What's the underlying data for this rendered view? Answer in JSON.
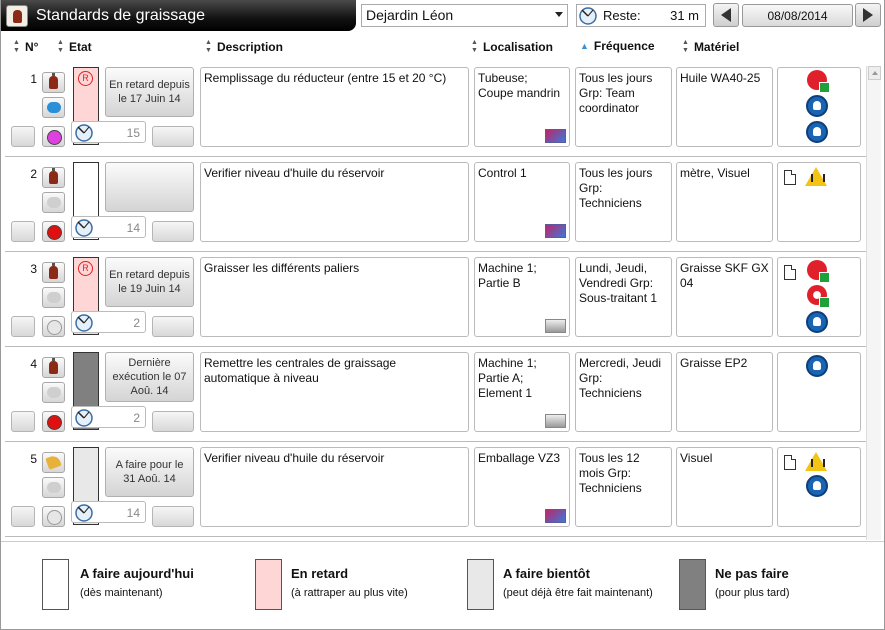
{
  "header": {
    "title": "Standards de graissage",
    "user": "Dejardin Léon",
    "reste_label": "Reste:",
    "reste_value": "31 m",
    "date": "08/08/2014"
  },
  "columns": {
    "num": "N°",
    "etat": "Etat",
    "description": "Description",
    "localisation": "Localisation",
    "frequence": "Fréquence",
    "materiel": "Matériel"
  },
  "rows": [
    {
      "num": "1",
      "state_label": "En retard depuis le 17 Juin 14",
      "status_color": "#ffd6d6",
      "dot_color": "#e040e0",
      "counter": "15",
      "description": "Remplissage du réducteur (entre 15 et 20 °C)",
      "localisation": "Tubeuse; Coupe mandrin",
      "frequence": "Tous les jours Grp: Team coordinator",
      "materiel": "Huile WA40-25",
      "icons": [
        "fire-hazard-icon",
        "ear-protection-icon",
        "glove-icon"
      ]
    },
    {
      "num": "2",
      "state_label": "",
      "status_color": "#ffffff",
      "dot_color": "#e01010",
      "counter": "14",
      "description": "Verifier niveau d'huile du réservoir",
      "localisation": "Control 1",
      "frequence": "Tous les jours Grp: Techniciens",
      "materiel": "mètre, Visuel",
      "icons": [
        "document-icon",
        "hot-surface-warning-icon"
      ]
    },
    {
      "num": "3",
      "state_label": "En retard depuis le 19 Juin 14",
      "status_color": "#ffd6d6",
      "dot_color": "",
      "counter": "2",
      "description": "Graisser les différents paliers",
      "localisation": "Machine 1; Partie B",
      "frequence": "Lundi, Jeudi, Vendredi Grp: Sous-traitant 1",
      "materiel": "Graisse SKF GX 04",
      "icons": [
        "document-icon",
        "fire-hazard-icon",
        "explosion-hazard-icon",
        "glove-icon"
      ]
    },
    {
      "num": "4",
      "state_label": "Dernière exécution le 07 Aoû. 14",
      "status_color": "#808080",
      "dot_color": "#e01010",
      "counter": "2",
      "description": "Remettre les centrales de graissage automatique à niveau",
      "localisation": "Machine 1; Partie A; Element 1",
      "frequence": "Mercredi, Jeudi Grp: Techniciens",
      "materiel": "Graisse EP2",
      "icons": [
        "glove-icon"
      ]
    },
    {
      "num": "5",
      "state_label": "A faire pour le 31 Aoû. 14",
      "status_color": "#e8e8e8",
      "dot_color": "",
      "counter": "14",
      "description": "Verifier niveau d'huile du réservoir",
      "localisation": "Emballage VZ3",
      "frequence": "Tous les 12 mois Grp: Techniciens",
      "materiel": "Visuel",
      "icons": [
        "document-icon",
        "hot-surface-warning-icon",
        "ear-protection-icon"
      ]
    }
  ],
  "legend": [
    {
      "title": "A faire aujourd'hui",
      "subtitle": "(dès maintenant)",
      "color": "#ffffff"
    },
    {
      "title": "En retard",
      "subtitle": "(à rattraper au plus vite)",
      "color": "#ffd6d6"
    },
    {
      "title": "A faire bientôt",
      "subtitle": "(peut déjà être fait maintenant)",
      "color": "#e8e8e8"
    },
    {
      "title": "Ne pas faire",
      "subtitle": "(pour plus tard)",
      "color": "#808080"
    }
  ]
}
